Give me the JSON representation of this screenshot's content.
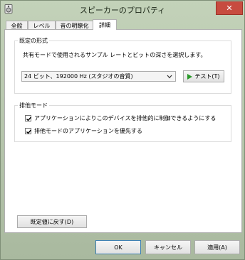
{
  "window": {
    "title": "スピーカーのプロパティ",
    "close_label": "✕"
  },
  "tabs": [
    {
      "label": "全般",
      "active": false
    },
    {
      "label": "レベル",
      "active": false
    },
    {
      "label": "音の明瞭化",
      "active": false
    },
    {
      "label": "詳細",
      "active": true
    }
  ],
  "default_format": {
    "group_label": "既定の形式",
    "description": "共有モードで使用されるサンプル レートとビットの深さを選択します。",
    "selected_format": "24 ビット、192000 Hz (スタジオの音質)",
    "test_button_label": "テスト(T)"
  },
  "exclusive_mode": {
    "group_label": "排他モード",
    "options": [
      {
        "label": "アプリケーションによりこのデバイスを排他的に制御できるようにする",
        "checked": true
      },
      {
        "label": "排他モードのアプリケーションを優先する",
        "checked": true
      }
    ]
  },
  "restore_defaults_label": "既定値に戻す(D)",
  "footer": {
    "ok_label": "OK",
    "cancel_label": "キャンセル",
    "apply_label": "適用(A)"
  },
  "colors": {
    "titlebar": "#b5c3ab",
    "close_button": "#c74b3f",
    "test_icon": "#2a9a2a"
  },
  "icons": {
    "app": "speaker-icon",
    "close": "close-icon",
    "dropdown": "chevron-down-icon",
    "test": "play-icon",
    "check": "checkmark-icon"
  }
}
